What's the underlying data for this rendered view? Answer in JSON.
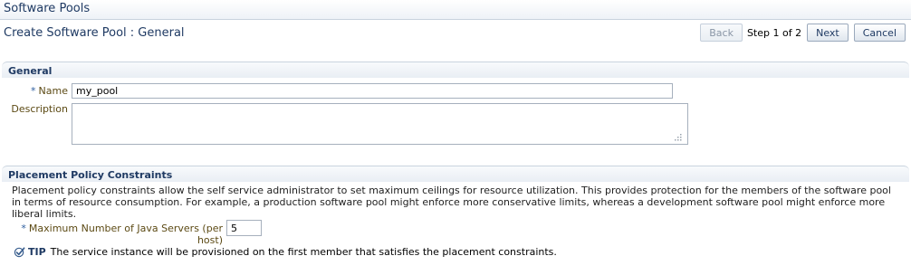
{
  "app": {
    "title": "Software Pools"
  },
  "page": {
    "title": "Create Software Pool : General"
  },
  "train": {
    "back_label": "Back",
    "step_text": "Step 1 of 2",
    "next_label": "Next",
    "cancel_label": "Cancel"
  },
  "general": {
    "header": "General",
    "name_label": "Name",
    "name_value": "my_pool",
    "description_label": "Description",
    "description_value": ""
  },
  "placement": {
    "header": "Placement Policy Constraints",
    "description": "Placement policy constraints allow the self service administrator to set maximum ceilings for resource utilization. This provides protection for the members of the software pool in terms of resource consumption. For example, a production software pool might enforce more conservative limits, whereas a development software pool might enforce more liberal limits.",
    "max_servers_label": "Maximum Number of Java Servers (per host)",
    "max_servers_value": "5",
    "tip_label": "TIP",
    "tip_text": "The service instance will be provisioned on the first member that satisfies the placement constraints."
  },
  "required_marker": "*"
}
